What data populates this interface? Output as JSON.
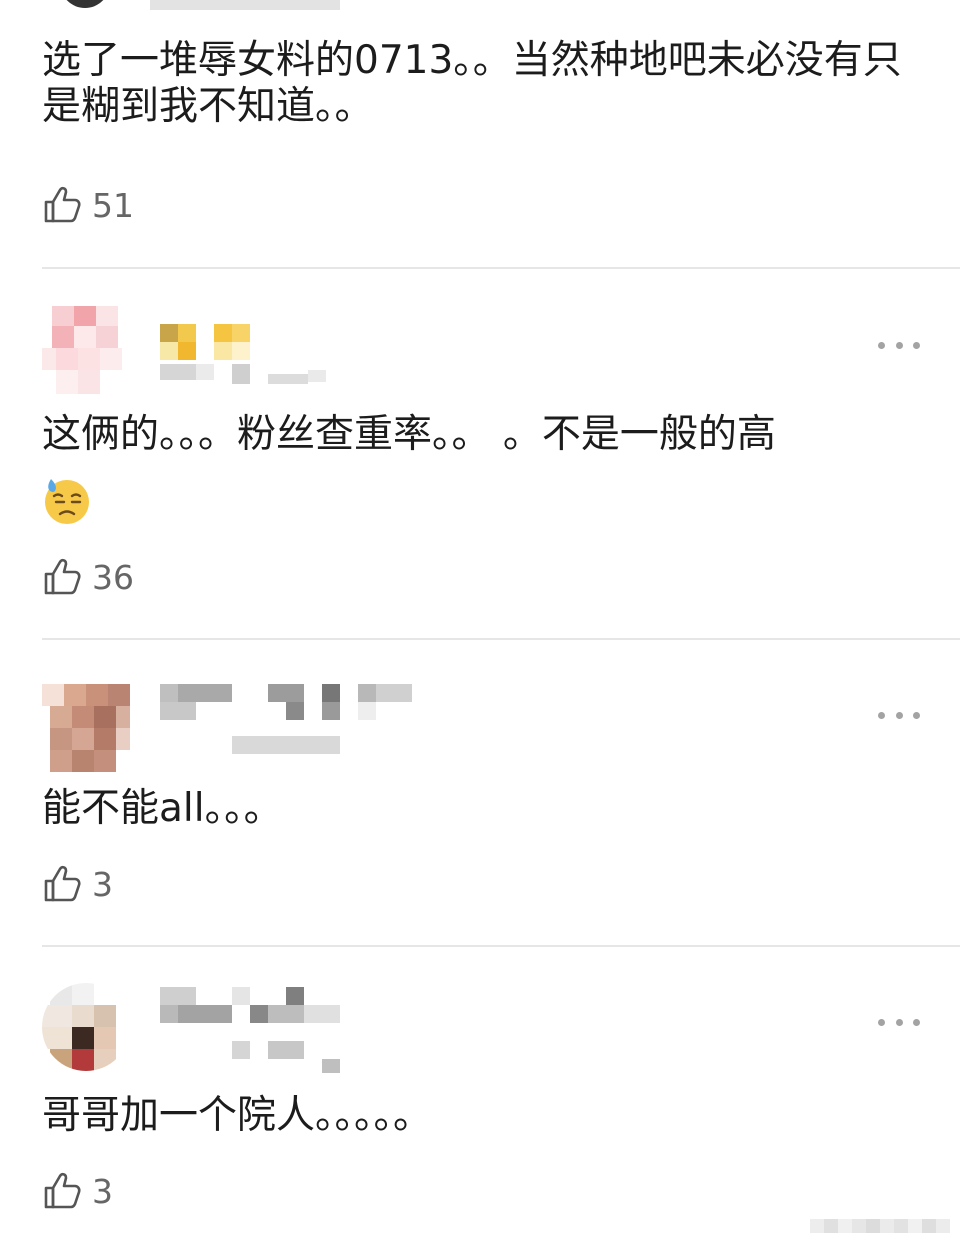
{
  "comments": [
    {
      "text": "选了一堆辱女料的0713。。当然种地吧未必没有只是糊到我不知道。。",
      "likes": "51"
    },
    {
      "text": "这俩的。。。粉丝查重率。。 。不是一般的高",
      "emoji": "downcast-face-with-sweat",
      "likes": "36"
    },
    {
      "text": "能不能all。。。",
      "likes": "3"
    },
    {
      "text": "哥哥加一个院人。。。。。",
      "likes": "3"
    }
  ],
  "icons": {
    "like": "thumbs-up-icon",
    "more": "more-dots-icon",
    "emoji": "sweat-downcast-emoji"
  },
  "colors": {
    "text": "#1c1c1c",
    "like_count": "#666666",
    "divider": "#e6e6e6",
    "more_dots": "#a3a3a3"
  }
}
